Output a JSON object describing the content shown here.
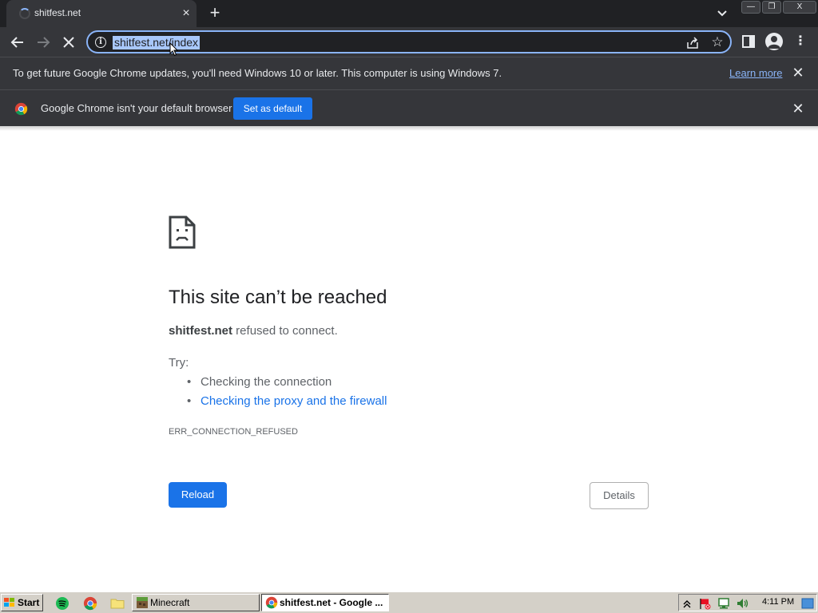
{
  "browser": {
    "tab": {
      "title": "shitfest.net"
    },
    "window_controls": {
      "minimize": "—",
      "restore": "❐",
      "close": "X"
    },
    "toolbar": {
      "url": "shitfest.net/index"
    },
    "infobar_update": {
      "message": "To get future Google Chrome updates, you'll need Windows 10 or later. This computer is using Windows 7.",
      "learn_more": "Learn more"
    },
    "infobar_default": {
      "message": "Google Chrome isn't your default browser",
      "button": "Set as default"
    }
  },
  "error_page": {
    "heading": "This site can’t be reached",
    "host": "shitfest.net",
    "host_suffix": " refused to connect.",
    "try_label": "Try:",
    "suggestions": [
      "Checking the connection",
      "Checking the proxy and the firewall"
    ],
    "error_code": "ERR_CONNECTION_REFUSED",
    "reload_label": "Reload",
    "details_label": "Details"
  },
  "taskbar": {
    "start_label": "Start",
    "tasks": [
      {
        "label": "Minecraft",
        "active": false
      },
      {
        "label": "shitfest.net - Google ...",
        "active": true
      }
    ],
    "time": "4:11 PM"
  },
  "colors": {
    "accent": "#1a73e8",
    "chrome_dark": "#35363a",
    "taskbar": "#d4d0c8"
  }
}
